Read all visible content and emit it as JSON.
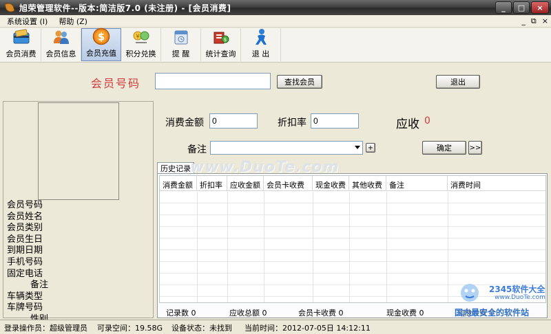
{
  "window": {
    "title": "旭荣管理软件--版本:简洁版7.0 (未注册) - [会员消费]",
    "minimize": "_",
    "maximize": "□",
    "close": "×"
  },
  "menu": {
    "items": [
      "系统设置 (I)",
      "帮助 (Z)"
    ],
    "mdi_minimize": "_",
    "mdi_restore": "⧉",
    "mdi_close": "×"
  },
  "toolbar": {
    "items": [
      {
        "label": "会员消费",
        "icon": "card-icon"
      },
      {
        "label": "会员信息",
        "icon": "users-icon"
      },
      {
        "label": "会员充值",
        "icon": "dollar-coin-icon"
      },
      {
        "label": "积分兑换",
        "icon": "gift-icon"
      },
      {
        "label": "提 醒",
        "icon": "reminder-icon"
      },
      {
        "label": "统计查询",
        "icon": "stats-icon"
      },
      {
        "label": "退 出",
        "icon": "exit-person-icon"
      }
    ],
    "active_index": 2
  },
  "search": {
    "label": "会员号码",
    "value": "",
    "find_button": "查找会员",
    "exit_button": "退出"
  },
  "member_info": {
    "fields": [
      "会员号码",
      "会员姓名",
      "会员类别",
      "会员生日",
      "到期日期",
      "手机号码",
      "固定电话",
      "备注",
      "车辆类型",
      "车牌号码",
      "性别"
    ]
  },
  "form": {
    "amount_label": "消费金额",
    "amount_value": "0",
    "discount_label": "折扣率",
    "discount_value": "0",
    "receivable_label": "应收",
    "receivable_value": "0",
    "remark_label": "备注",
    "plus_button": "+",
    "ok_button": "确定",
    "next_button": ">>"
  },
  "history": {
    "tab_label": "历史记录",
    "columns": [
      "消费金额",
      "折扣率",
      "应收金额",
      "会员卡收费",
      "现金收费",
      "其他收费",
      "备注",
      "消费时间"
    ],
    "summary": {
      "record_count": "记录数 0",
      "receivable_total": "应收总额 0",
      "card_total": "会员卡收费 0",
      "cash_total": "现金收费 0",
      "other_total": "其他收费 0"
    }
  },
  "watermark": {
    "text": "www.DuoTe.com",
    "brand": "2345软件大全",
    "brand_url": "www.DuoTe.com",
    "slogan": "国内最安全的软件站"
  },
  "status": {
    "operator": "登录操作员：超级管理员",
    "space": "可录空间：19.58G",
    "device": "设备状态：未找到",
    "time": "当前时间：2012-07-05日 14:12:11"
  },
  "colors": {
    "accent_red": "#d23b3b",
    "titlebar_dark": "#2a2a2a"
  }
}
